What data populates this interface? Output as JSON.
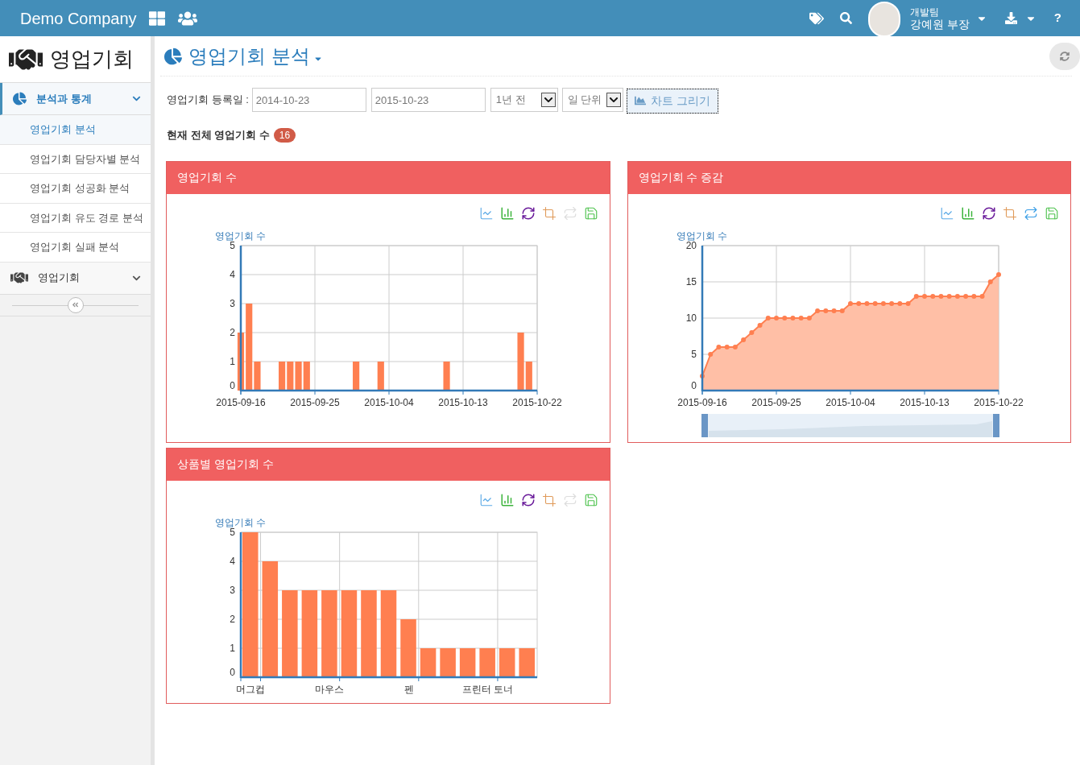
{
  "header": {
    "brand": "Demo Company",
    "user": {
      "team": "개발팀",
      "name": "강예원 부장"
    },
    "help": "?"
  },
  "sidebar": {
    "title": "영업기회",
    "sections": [
      {
        "kind": "pie",
        "label": "분석과 통계",
        "expanded": true,
        "children": [
          {
            "label": "영업기회 분석",
            "selected": true
          },
          {
            "label": "영업기회 담당자별 분석",
            "selected": false
          },
          {
            "label": "영업기회 성공화 분석",
            "selected": false
          },
          {
            "label": "영업기회 유도 경로 분석",
            "selected": false
          },
          {
            "label": "영업기회 실패 분석",
            "selected": false
          }
        ]
      },
      {
        "kind": "handshake",
        "label": "영업기회",
        "expanded": false
      }
    ]
  },
  "page": {
    "title": "영업기회 분석"
  },
  "filter": {
    "label": "영업기회 등록일 :",
    "from": "2014-10-23",
    "to": "2015-10-23",
    "range": "1년 전",
    "unit": "일 단위",
    "button": "차트 그리기"
  },
  "total": {
    "label": "현재 전체 영업기회 수",
    "count": "16"
  },
  "panels": [
    {
      "title": "영업기회 수",
      "restore_enabled": false,
      "chart_data": {
        "type": "bar",
        "ylabel": "영업기회 수",
        "x": [
          "2015-09-16",
          "2015-09-17",
          "2015-09-18",
          "2015-09-21",
          "2015-09-22",
          "2015-09-23",
          "2015-09-24",
          "2015-09-30",
          "2015-10-03",
          "2015-10-11",
          "2015-10-20",
          "2015-10-21"
        ],
        "values": [
          2,
          3,
          1,
          1,
          1,
          1,
          1,
          1,
          1,
          1,
          2,
          1
        ],
        "grid": true,
        "xlim": [
          "2015-09-16",
          "2015-10-22"
        ],
        "ylim": [
          0,
          5
        ],
        "yticks": [
          0,
          1,
          2,
          3,
          4,
          5
        ],
        "xticks": [
          "2015-09-16",
          "2015-09-25",
          "2015-10-04",
          "2015-10-13",
          "2015-10-22"
        ]
      }
    },
    {
      "title": "영업기회 수 증감",
      "restore_enabled": true,
      "chart_data": {
        "type": "area",
        "ylabel": "영업기회 수",
        "x": [
          "2015-09-16",
          "2015-09-17",
          "2015-09-18",
          "2015-09-19",
          "2015-09-20",
          "2015-09-21",
          "2015-09-22",
          "2015-09-23",
          "2015-09-24",
          "2015-09-25",
          "2015-09-26",
          "2015-09-27",
          "2015-09-28",
          "2015-09-29",
          "2015-09-30",
          "2015-10-01",
          "2015-10-02",
          "2015-10-03",
          "2015-10-04",
          "2015-10-05",
          "2015-10-06",
          "2015-10-07",
          "2015-10-08",
          "2015-10-09",
          "2015-10-10",
          "2015-10-11",
          "2015-10-12",
          "2015-10-13",
          "2015-10-14",
          "2015-10-15",
          "2015-10-16",
          "2015-10-17",
          "2015-10-18",
          "2015-10-19",
          "2015-10-20",
          "2015-10-21",
          "2015-10-22"
        ],
        "values": [
          2,
          5,
          6,
          6,
          6,
          7,
          8,
          9,
          10,
          10,
          10,
          10,
          10,
          10,
          11,
          11,
          11,
          11,
          12,
          12,
          12,
          12,
          12,
          12,
          12,
          12,
          13,
          13,
          13,
          13,
          13,
          13,
          13,
          13,
          13,
          15,
          16
        ],
        "grid": true,
        "xlim": [
          "2015-09-16",
          "2015-10-22"
        ],
        "ylim": [
          0,
          20
        ],
        "yticks": [
          0,
          5,
          10,
          15,
          20
        ],
        "xticks": [
          "2015-09-16",
          "2015-09-25",
          "2015-10-04",
          "2015-10-13",
          "2015-10-22"
        ]
      }
    },
    {
      "title": "상품별 영업기회 수",
      "restore_enabled": false,
      "chart_data": {
        "type": "bar",
        "ylabel": "영업기회 수",
        "grid": true,
        "categories": [
          "머그컵",
          null,
          null,
          null,
          "마우스",
          null,
          null,
          null,
          "펜",
          null,
          null,
          null,
          "프린터 토너",
          null,
          null
        ],
        "values": [
          5,
          4,
          3,
          3,
          3,
          3,
          3,
          3,
          2,
          1,
          1,
          1,
          1,
          1,
          1
        ],
        "ylim": [
          0,
          5
        ],
        "yticks": [
          0,
          1,
          2,
          3,
          4,
          5
        ]
      }
    }
  ]
}
